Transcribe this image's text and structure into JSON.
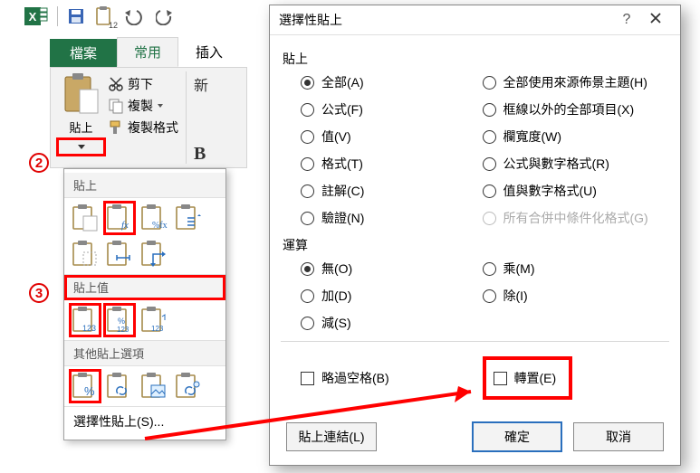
{
  "qat": {
    "badge": "12"
  },
  "tabs": {
    "file": "檔案",
    "home": "常用",
    "insert": "插入"
  },
  "clipboard": {
    "paste_label": "貼上",
    "cut": "剪下",
    "copy": "複製",
    "format_painter": "複製格式"
  },
  "font": {
    "new_font_prefix": "新",
    "bold": "B"
  },
  "gallery": {
    "section_paste": "貼上",
    "section_values": "貼上值",
    "section_other": "其他貼上選項",
    "special": "選擇性貼上(S)..."
  },
  "callouts": {
    "two": "2",
    "three": "3"
  },
  "dialog": {
    "title": "選擇性貼上",
    "grp_paste": "貼上",
    "grp_op": "運算",
    "paste_options": {
      "all": "全部(A)",
      "formulas": "公式(F)",
      "values": "值(V)",
      "formats": "格式(T)",
      "comments": "註解(C)",
      "validation": "驗證(N)",
      "all_theme": "全部使用來源佈景主題(H)",
      "except_borders": "框線以外的全部項目(X)",
      "col_widths": "欄寬度(W)",
      "formulas_num": "公式與數字格式(R)",
      "values_num": "值與數字格式(U)",
      "all_cond": "所有合併中條件化格式(G)"
    },
    "op_options": {
      "none": "無(O)",
      "add": "加(D)",
      "subtract": "減(S)",
      "multiply": "乘(M)",
      "divide": "除(I)"
    },
    "chk_skip": "略過空格(B)",
    "chk_transpose": "轉置(E)",
    "btn_link": "貼上連結(L)",
    "btn_ok": "確定",
    "btn_cancel": "取消"
  }
}
